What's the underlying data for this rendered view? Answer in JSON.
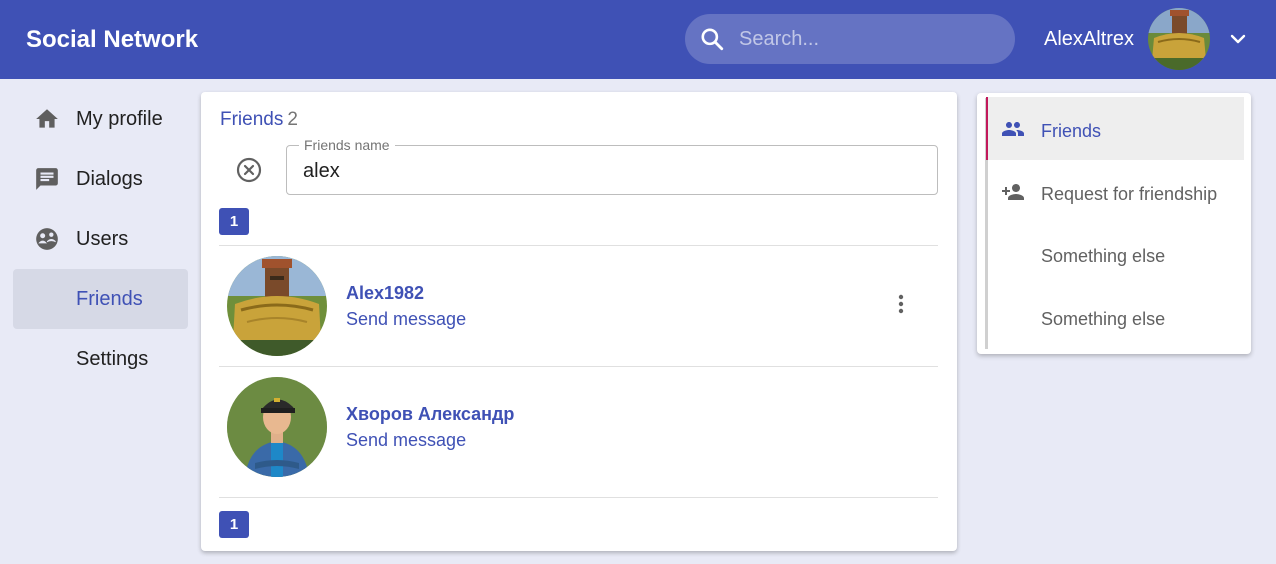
{
  "header": {
    "logo": "Social Network",
    "search_placeholder": "Search...",
    "username": "AlexAltrex"
  },
  "sidebar": {
    "items": [
      {
        "label": "My profile",
        "icon": "home-icon"
      },
      {
        "label": "Dialogs",
        "icon": "chat-icon"
      },
      {
        "label": "Users",
        "icon": "users-icon"
      },
      {
        "label": "Friends",
        "icon": "",
        "active": true
      },
      {
        "label": "Settings",
        "icon": ""
      }
    ]
  },
  "friends": {
    "title": "Friends",
    "count": "2",
    "filter_label": "Friends name",
    "filter_value": "alex",
    "page_top": "1",
    "page_bottom": "1",
    "list": [
      {
        "name": "Alex1982",
        "action": "Send message"
      },
      {
        "name": "Хворов Александр",
        "action": "Send message"
      }
    ]
  },
  "menu": {
    "items": [
      {
        "label": "Friends",
        "icon": "people-icon",
        "active": true
      },
      {
        "label": "Request for friendship",
        "icon": "person-add-icon"
      },
      {
        "label": "Something else",
        "icon": ""
      },
      {
        "label": "Something else",
        "icon": ""
      }
    ]
  },
  "colors": {
    "primary": "#3f51b5",
    "search_bg": "#6573c3",
    "background": "#e8eaf6",
    "menu_active_bar": "#c2185b"
  }
}
